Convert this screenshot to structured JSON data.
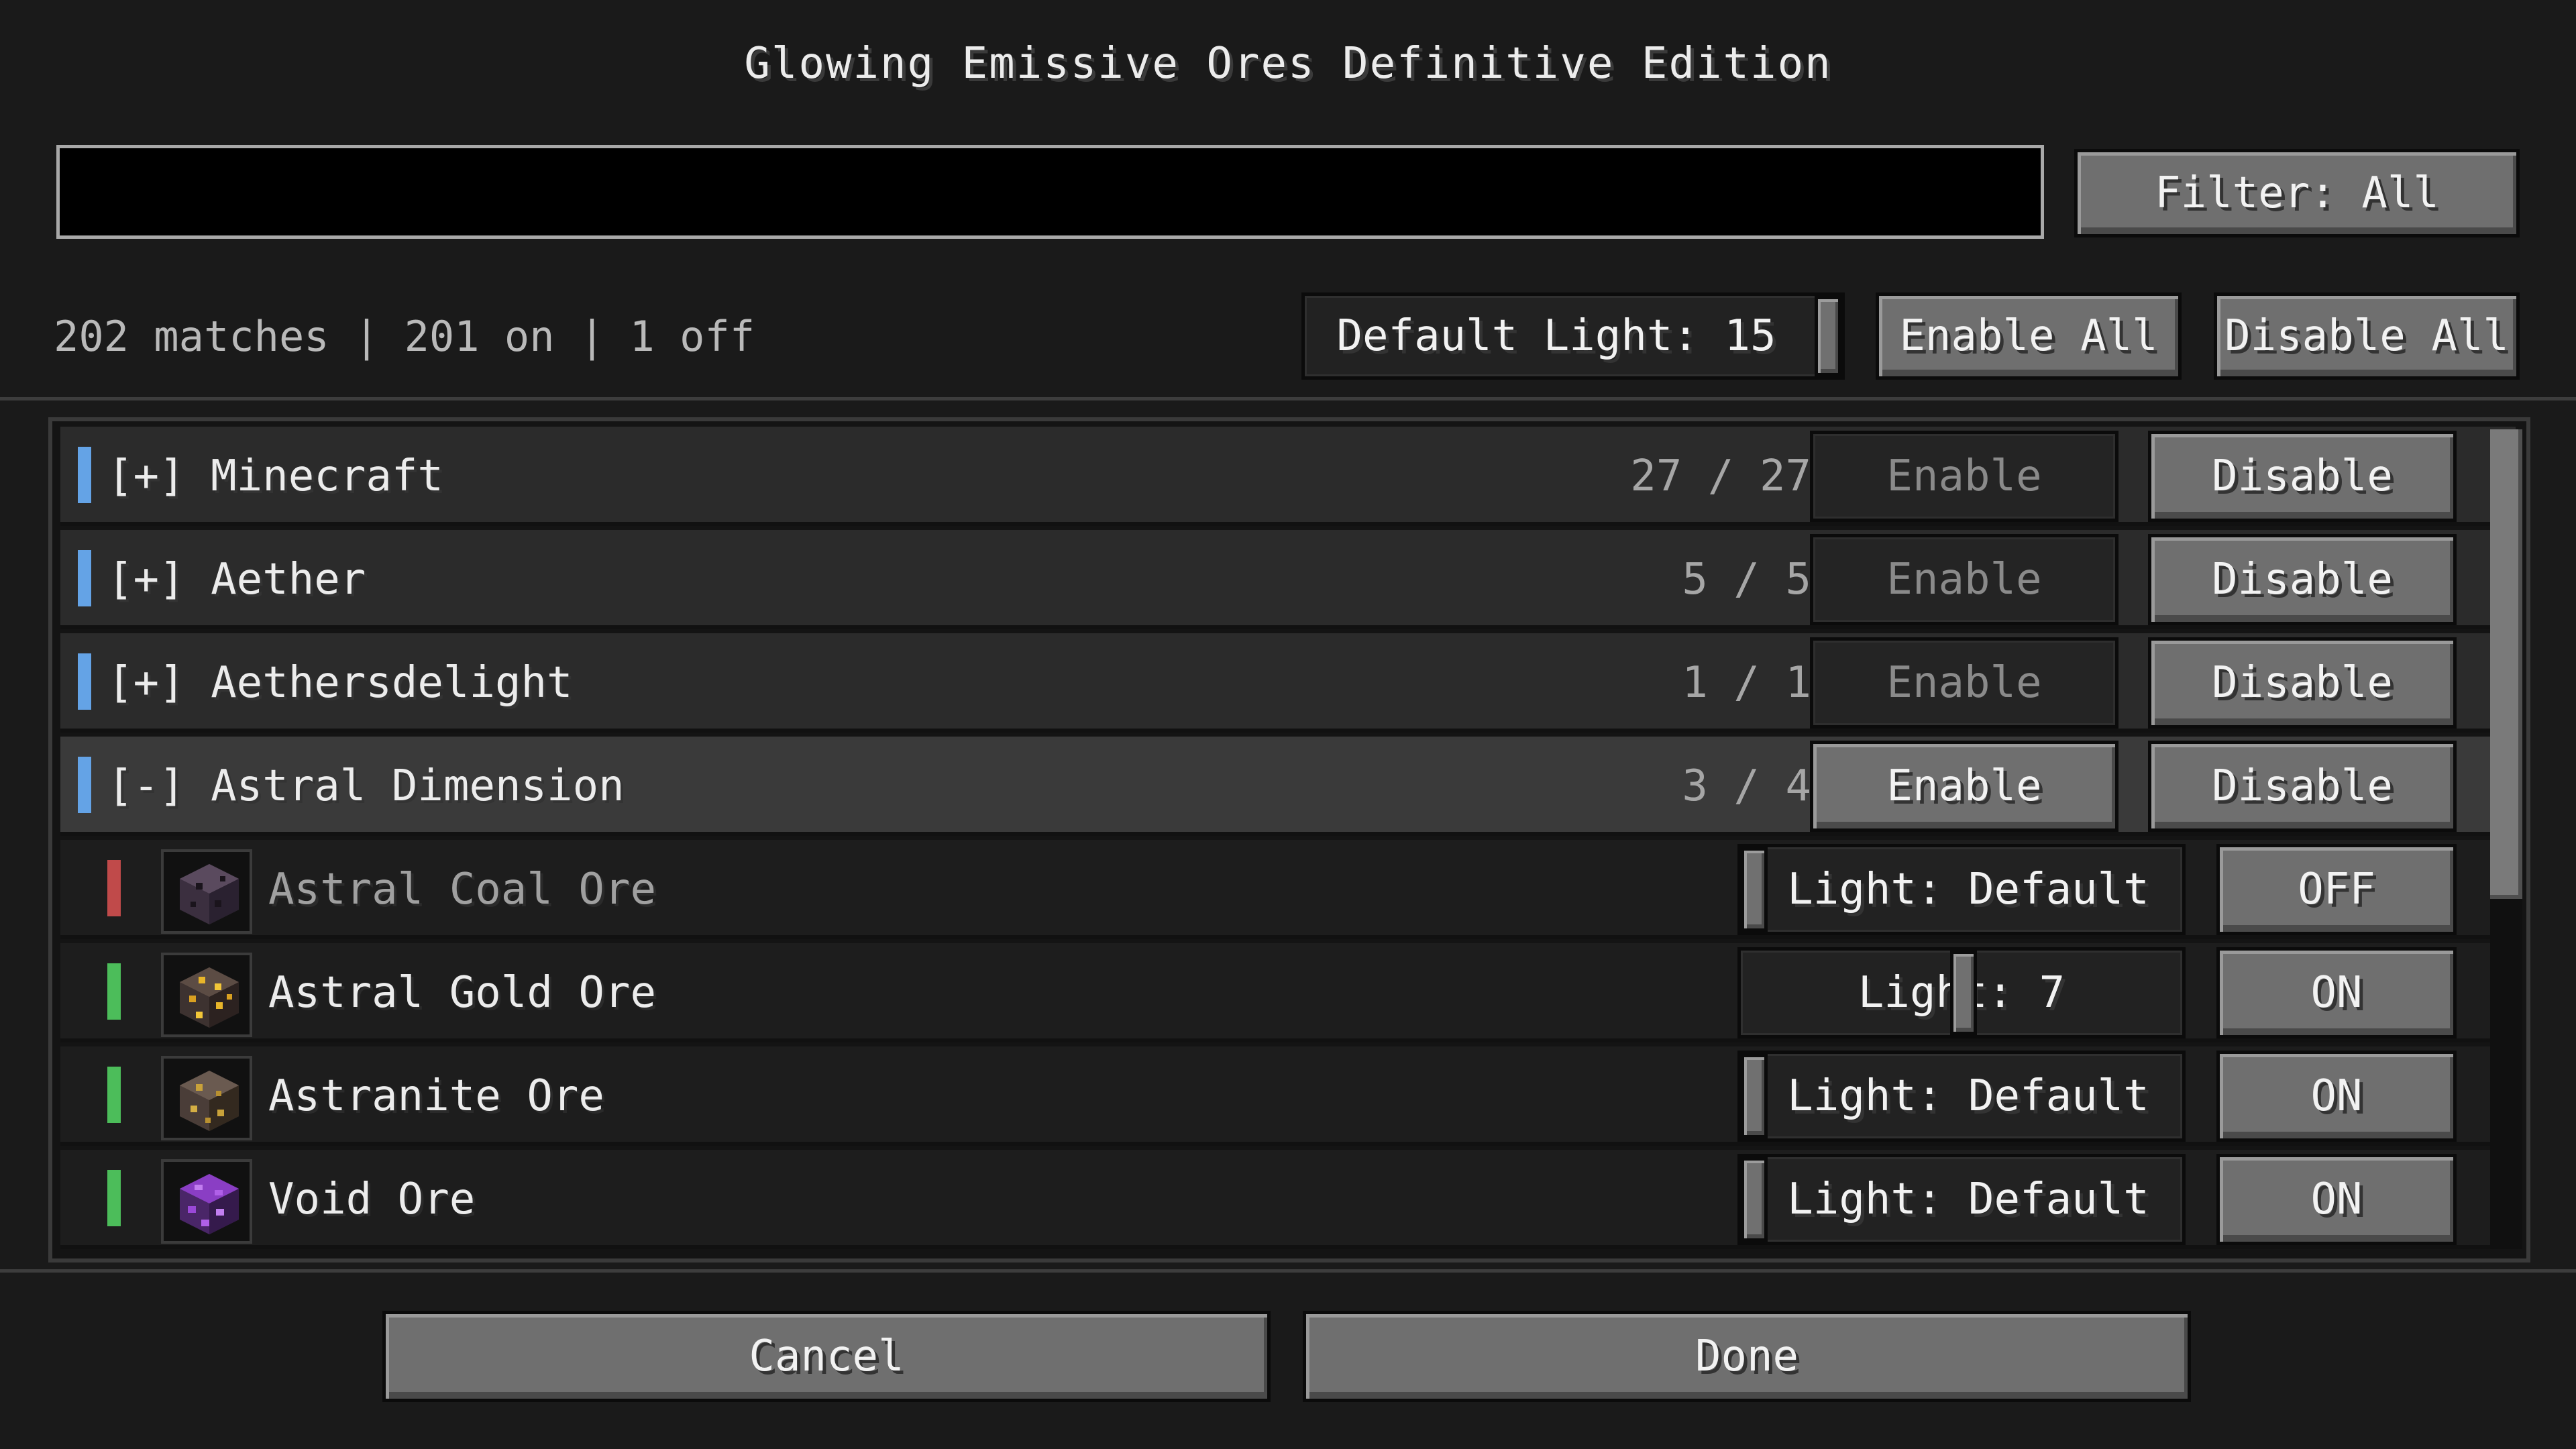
{
  "title": "Glowing Emissive Ores Definitive Edition",
  "search": {
    "value": "",
    "placeholder": ""
  },
  "filter_button": "Filter: All",
  "status": "202 matches | 201 on | 1 off",
  "default_light": {
    "label": "Default Light: 15",
    "value": 15,
    "max": 15
  },
  "enable_all": "Enable All",
  "disable_all": "Disable All",
  "colors": {
    "group_bar": "#64a3e6",
    "on_bar": "#4cbd5a",
    "off_bar": "#c04a4a"
  },
  "groups": [
    {
      "toggle": "[+]",
      "name": "Minecraft",
      "count": "27 / 27",
      "enable": "Enable",
      "disable": "Disable",
      "enable_active": false
    },
    {
      "toggle": "[+]",
      "name": "Aether",
      "count": "5 / 5",
      "enable": "Enable",
      "disable": "Disable",
      "enable_active": false
    },
    {
      "toggle": "[+]",
      "name": "Aethersdelight",
      "count": "1 / 1",
      "enable": "Enable",
      "disable": "Disable",
      "enable_active": false
    },
    {
      "toggle": "[-]",
      "name": "Astral Dimension",
      "count": "3 / 4",
      "enable": "Enable",
      "disable": "Disable",
      "enable_active": true
    }
  ],
  "items": [
    {
      "name": "Astral Coal Ore",
      "icon": "astral-coal-ore-icon",
      "light_label": "Light: Default",
      "light_value": 0,
      "state": "OFF",
      "enabled": false
    },
    {
      "name": "Astral Gold Ore",
      "icon": "astral-gold-ore-icon",
      "light_label": "Light: 7",
      "light_value": 7,
      "state": "ON",
      "enabled": true
    },
    {
      "name": "Astranite Ore",
      "icon": "astranite-ore-icon",
      "light_label": "Light: Default",
      "light_value": 0,
      "state": "ON",
      "enabled": true
    },
    {
      "name": "Void Ore",
      "icon": "void-ore-icon",
      "light_label": "Light: Default",
      "light_value": 0,
      "state": "ON",
      "enabled": true
    }
  ],
  "cancel": "Cancel",
  "done": "Done"
}
